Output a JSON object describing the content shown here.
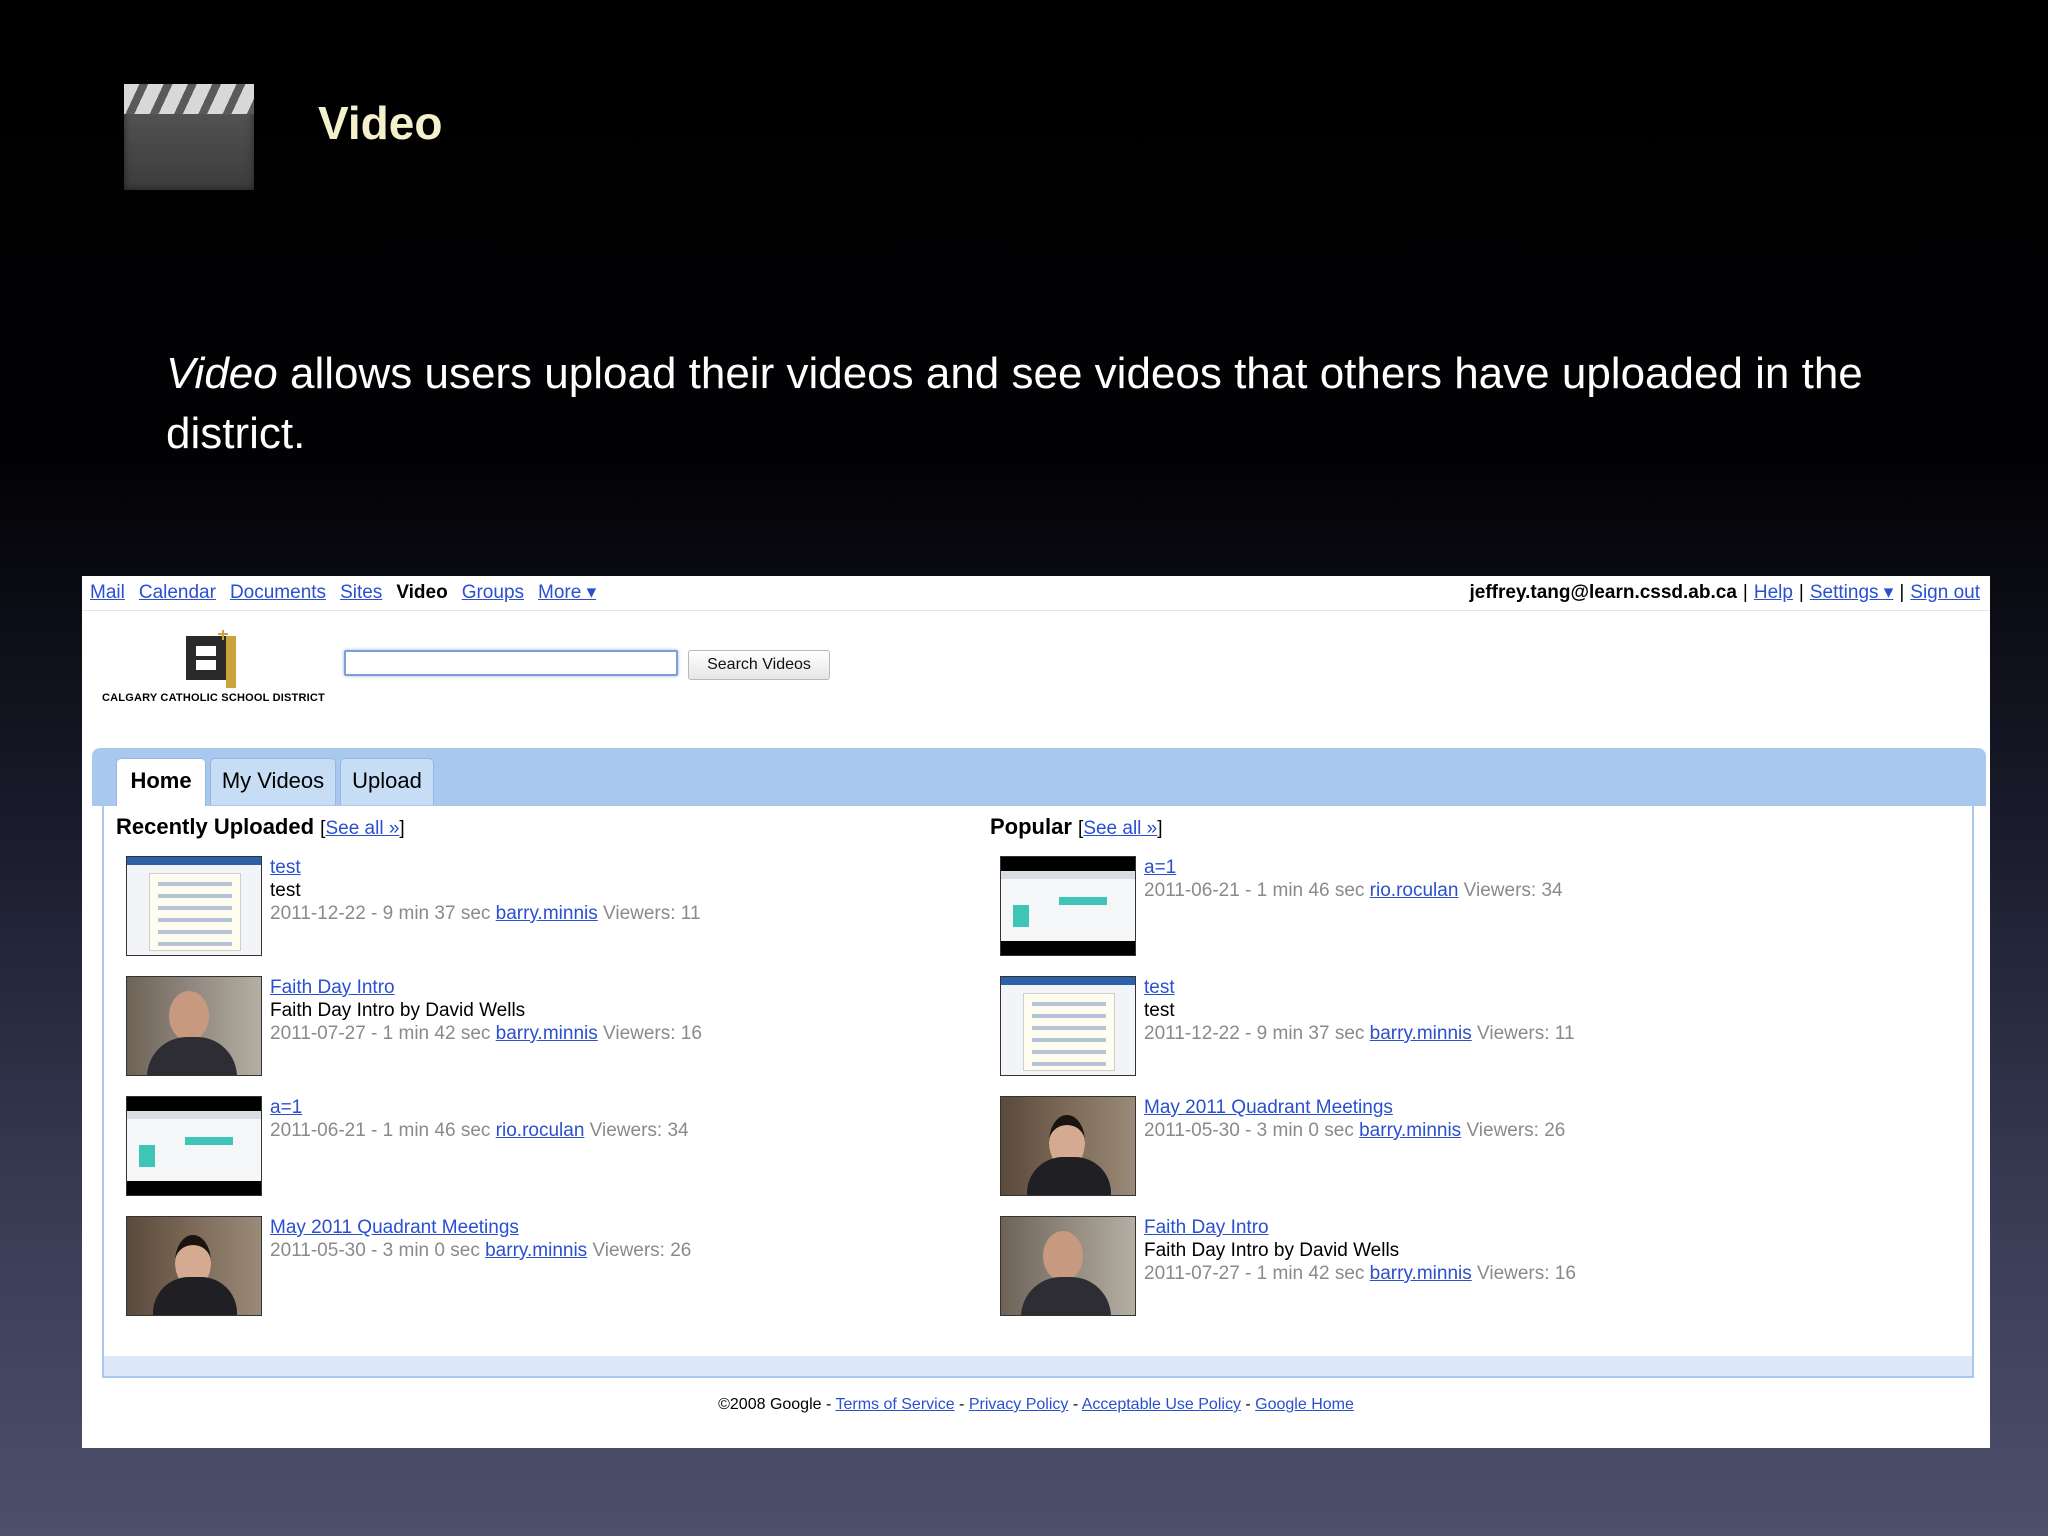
{
  "slide": {
    "title": "Video",
    "body_em": "Video",
    "body_rest": " allows users upload their videos and see videos that others have uploaded in the district."
  },
  "app": {
    "nav": [
      {
        "label": "Mail"
      },
      {
        "label": "Calendar"
      },
      {
        "label": "Documents"
      },
      {
        "label": "Sites"
      },
      {
        "label": "Video",
        "current": true
      },
      {
        "label": "Groups"
      },
      {
        "label": "More ▾"
      }
    ],
    "user_email": "jeffrey.tang@learn.cssd.ab.ca",
    "sep": "|",
    "help": "Help",
    "settings": "Settings ▾",
    "sign_out": "Sign out",
    "logo_caption": "CALGARY CATHOLIC SCHOOL DISTRICT",
    "search": {
      "value": "",
      "button": "Search Videos"
    },
    "tabs": [
      "Home",
      "My Videos",
      "Upload"
    ],
    "recent": {
      "title": "Recently Uploaded",
      "see_all_open": "[",
      "see_all": "See all »",
      "see_all_close": "]",
      "items": [
        {
          "title": "test",
          "desc": "test",
          "info": "2011-12-22 - 9 min 37 sec",
          "user": "barry.minnis",
          "viewers": "Viewers: 11",
          "thumb": "screen"
        },
        {
          "title": "Faith Day Intro",
          "desc": "Faith Day Intro by David Wells",
          "info": "2011-07-27 - 1 min 42 sec",
          "user": "barry.minnis",
          "viewers": "Viewers: 16",
          "thumb": "person"
        },
        {
          "title": "a=1",
          "desc": "",
          "info": "2011-06-21 - 1 min 46 sec",
          "user": "rio.roculan",
          "viewers": "Viewers: 34",
          "thumb": "black"
        },
        {
          "title": "May 2011 Quadrant Meetings",
          "desc": "",
          "info": "2011-05-30 - 3 min 0 sec",
          "user": "barry.minnis",
          "viewers": "Viewers: 26",
          "thumb": "person2"
        }
      ]
    },
    "popular": {
      "title": "Popular",
      "see_all_open": "[",
      "see_all": "See all »",
      "see_all_close": "]",
      "items": [
        {
          "title": "a=1",
          "desc": "",
          "info": "2011-06-21 - 1 min 46 sec",
          "user": "rio.roculan",
          "viewers": "Viewers: 34",
          "thumb": "black"
        },
        {
          "title": "test",
          "desc": "test",
          "info": "2011-12-22 - 9 min 37 sec",
          "user": "barry.minnis",
          "viewers": "Viewers: 11",
          "thumb": "screen"
        },
        {
          "title": "May 2011 Quadrant Meetings",
          "desc": "",
          "info": "2011-05-30 - 3 min 0 sec",
          "user": "barry.minnis",
          "viewers": "Viewers: 26",
          "thumb": "person2"
        },
        {
          "title": "Faith Day Intro",
          "desc": "Faith Day Intro by David Wells",
          "info": "2011-07-27 - 1 min 42 sec",
          "user": "barry.minnis",
          "viewers": "Viewers: 16",
          "thumb": "person"
        }
      ]
    },
    "footer": {
      "copyright": "©2008 Google",
      "dash": " - ",
      "links": [
        "Terms of Service",
        "Privacy Policy",
        "Acceptable Use Policy",
        "Google Home"
      ]
    }
  }
}
